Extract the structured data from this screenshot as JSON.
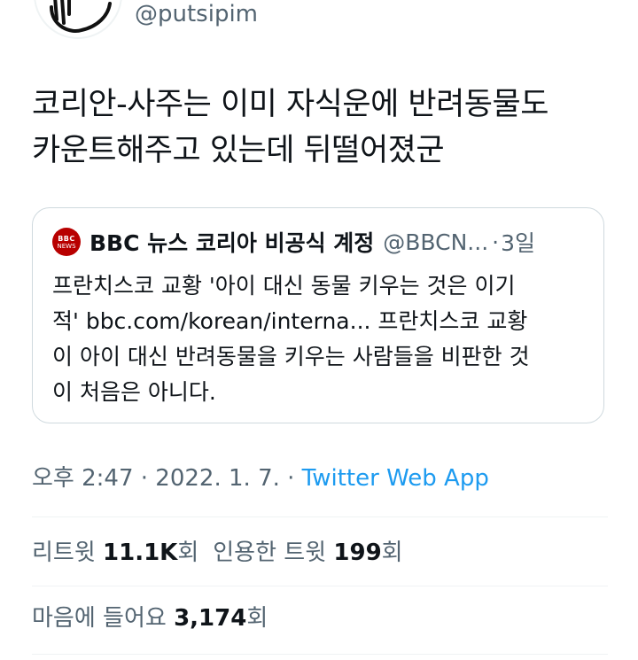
{
  "author": {
    "handle": "@putsipim"
  },
  "tweet": {
    "lines": [
      "코리안-사주는 이미 자식운에 반려동물도",
      "카운트해주고 있는데 뒤떨어졌군"
    ]
  },
  "quote": {
    "avatar_logo": "BBC",
    "avatar_sub": "NEWS",
    "name": "BBC 뉴스 코리아 비공식 계정",
    "handle": "@BBCN...",
    "separator": "·",
    "time": "3일",
    "lines": [
      "프란치스코 교황 '아이 대신 동물 키우는 것은 이기",
      "적' bbc.com/korean/interna... 프란치스코 교황",
      "이 아이 대신 반려동물을 키우는 사람들을 비판한 것",
      "이 처음은 아니다."
    ]
  },
  "meta": {
    "time": "오후 2:47",
    "sep1": " · ",
    "date": "2022. 1. 7.",
    "sep2": " · ",
    "source": "Twitter Web App"
  },
  "stats": {
    "retweet_label": "리트윗 ",
    "retweet_count": "11.1K",
    "retweet_unit": "회",
    "quote_label": "인용한 트윗 ",
    "quote_count": "199",
    "quote_unit": "회",
    "like_label": "마음에 들어요 ",
    "like_count": "3,174",
    "like_unit": "회"
  },
  "colors": {
    "text": "#0f1419",
    "secondary": "#536471",
    "link": "#1d9bf0",
    "border": "#cfd9de",
    "divider": "#eff3f4",
    "bbc_red": "#b80000"
  }
}
